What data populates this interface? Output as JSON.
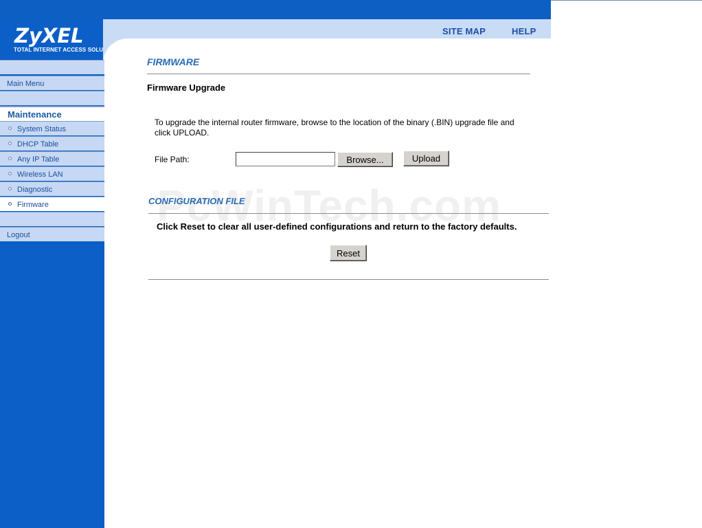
{
  "header": {
    "logo": "ZyXEL",
    "tagline": "TOTAL INTERNET ACCESS SOLUTION",
    "links": [
      "SITE MAP",
      "HELP"
    ]
  },
  "sidebar": {
    "main_menu": "Main Menu",
    "section": "Maintenance",
    "items": [
      {
        "label": "System Status"
      },
      {
        "label": "DHCP Table"
      },
      {
        "label": "Any IP Table"
      },
      {
        "label": "Wireless LAN"
      },
      {
        "label": "Diagnostic"
      },
      {
        "label": "Firmware",
        "active": true
      }
    ],
    "logout": "Logout"
  },
  "firmware": {
    "title": "FIRMWARE",
    "subtitle": "Firmware Upgrade",
    "description": "To upgrade the internal router firmware, browse to the location of the binary (.BIN) upgrade file and click UPLOAD.",
    "file_path_label": "File Path:",
    "file_path_value": "",
    "browse_label": "Browse...",
    "upload_label": "Upload"
  },
  "config": {
    "title": "CONFIGURATION FILE",
    "reset_text": "Click Reset to clear all user-defined configurations and return to the factory defaults.",
    "reset_label": "Reset"
  },
  "watermark": "PcWinTech.com",
  "colors": {
    "brand_blue": "#0b5fc6",
    "nav_light": "#c6d8f4",
    "title_blue": "#2a6ab3"
  }
}
